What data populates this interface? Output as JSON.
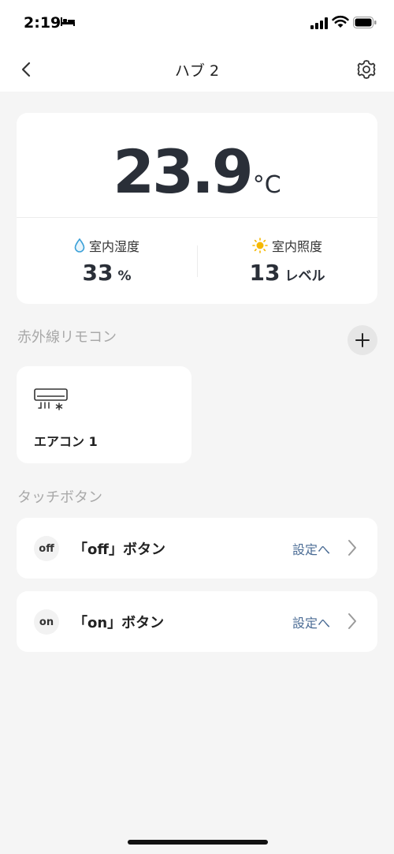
{
  "status_bar": {
    "time": "2:19"
  },
  "nav": {
    "title": "ハブ 2"
  },
  "sensor": {
    "temperature": "23.9",
    "temperature_unit": "°C",
    "humidity_label": "室内湿度",
    "humidity_value": "33",
    "humidity_unit": "%",
    "light_label": "室内照度",
    "light_value": "13",
    "light_unit": "レベル"
  },
  "ir_section": {
    "title": "赤外線リモコン",
    "remotes": [
      {
        "name": "エアコン 1"
      }
    ]
  },
  "touch_section": {
    "title": "タッチボタン",
    "buttons": [
      {
        "badge": "off",
        "label": "「off」ボタン",
        "action": "設定へ"
      },
      {
        "badge": "on",
        "label": "「on」ボタン",
        "action": "設定へ"
      }
    ]
  },
  "colors": {
    "accent_link": "#4a6b94",
    "humidity_icon": "#3aa0d8",
    "light_icon": "#f5b800"
  },
  "icons": [
    "bed-icon",
    "signal-icon",
    "wifi-icon",
    "battery-icon",
    "back-arrow-icon",
    "gear-icon",
    "water-drop-icon",
    "sun-icon",
    "plus-icon",
    "air-conditioner-icon",
    "chevron-right-icon"
  ]
}
